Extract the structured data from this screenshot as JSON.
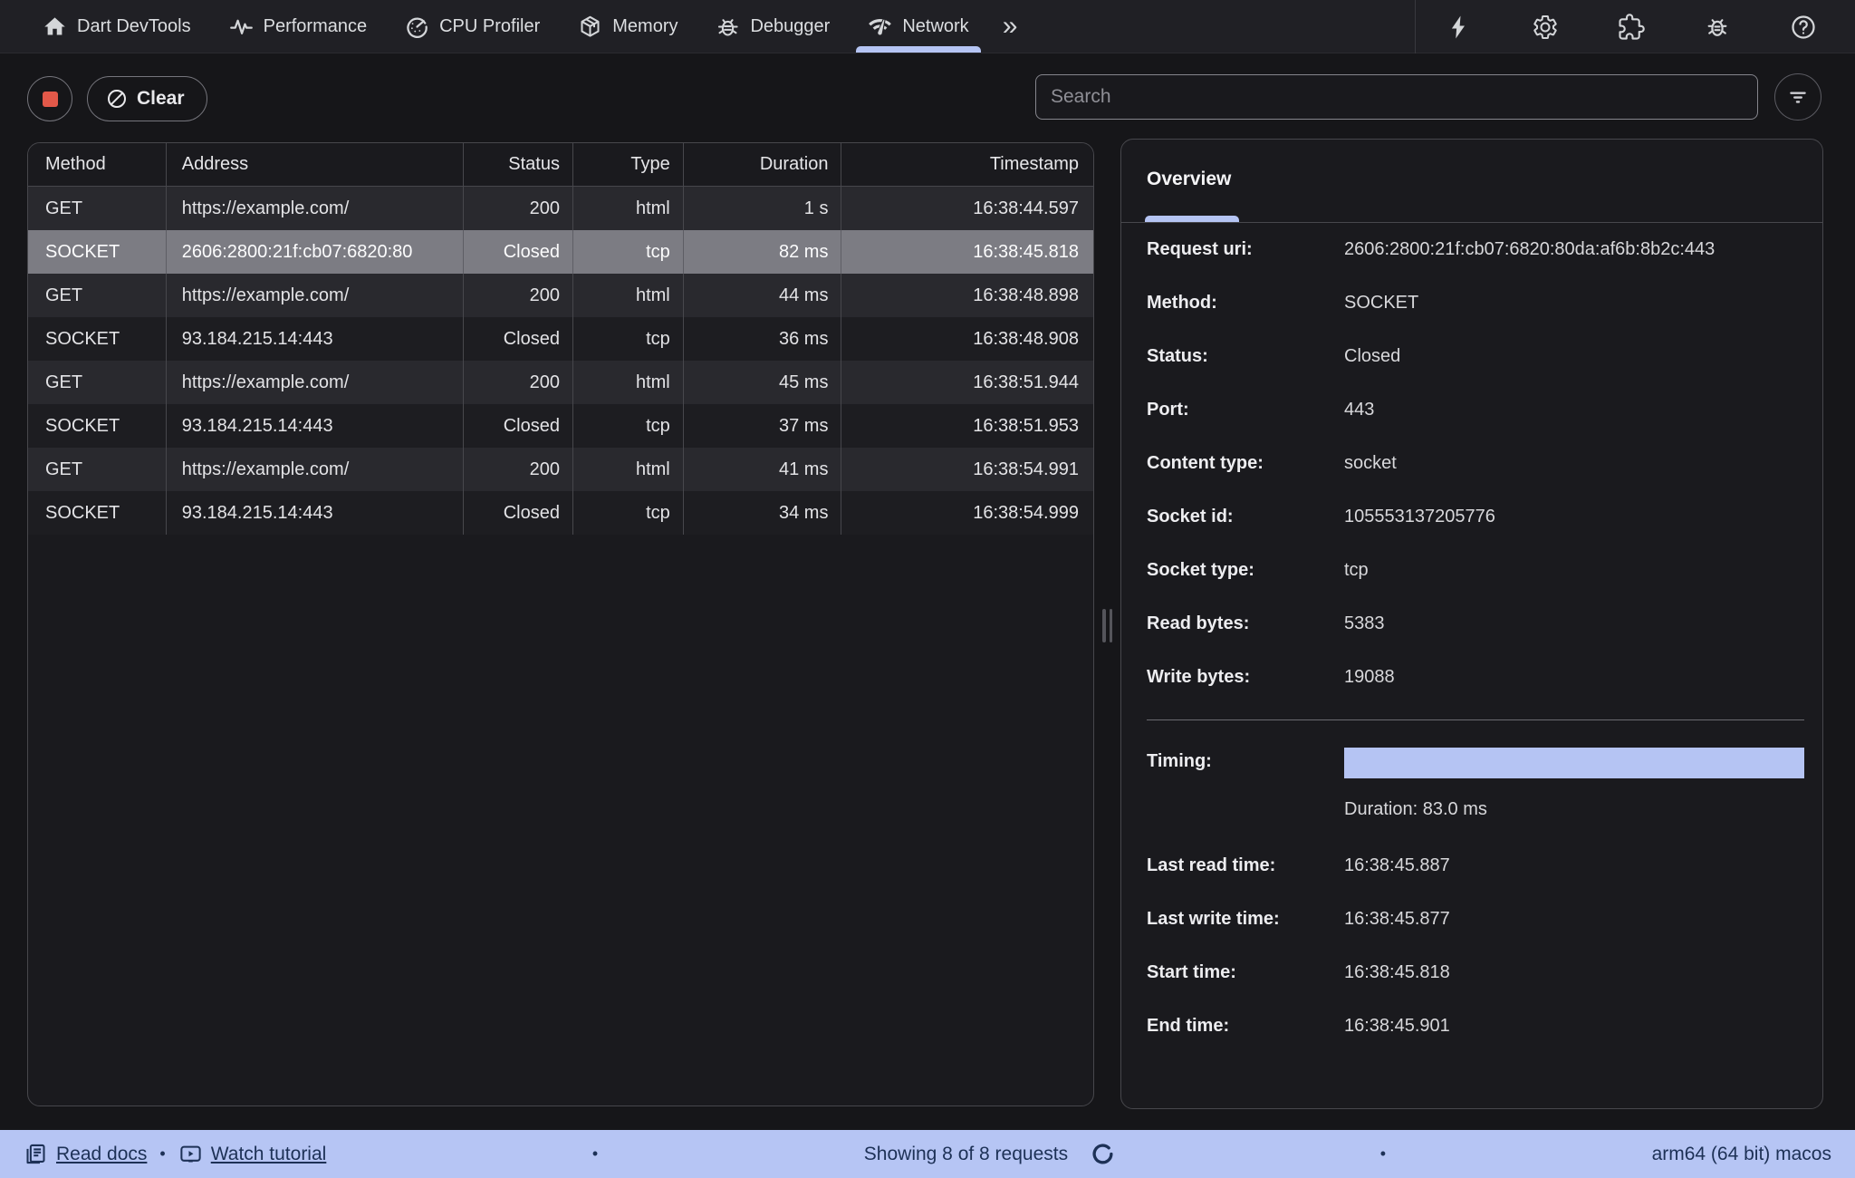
{
  "topnav": {
    "items": [
      {
        "label": "Dart DevTools",
        "icon": "home-icon",
        "selected": false
      },
      {
        "label": "Performance",
        "icon": "performance-icon",
        "selected": false
      },
      {
        "label": "CPU Profiler",
        "icon": "cpu-profiler-icon",
        "selected": false
      },
      {
        "label": "Memory",
        "icon": "memory-icon",
        "selected": false
      },
      {
        "label": "Debugger",
        "icon": "debugger-icon",
        "selected": false
      },
      {
        "label": "Network",
        "icon": "network-icon",
        "selected": true
      }
    ],
    "overflow_glyph": "»",
    "action_icons": [
      "lightning-icon",
      "settings-icon",
      "extensions-icon",
      "report-bug-icon",
      "help-icon"
    ]
  },
  "toolbar": {
    "clear_label": "Clear",
    "search_placeholder": "Search",
    "search_value": ""
  },
  "table": {
    "columns": [
      "Method",
      "Address",
      "Status",
      "Type",
      "Duration",
      "Timestamp"
    ],
    "rows": [
      {
        "method": "GET",
        "address": "https://example.com/",
        "status": "200",
        "type": "html",
        "duration": "1 s",
        "timestamp": "16:38:44.597"
      },
      {
        "method": "SOCKET",
        "address": "2606:2800:21f:cb07:6820:80",
        "status": "Closed",
        "type": "tcp",
        "duration": "82 ms",
        "timestamp": "16:38:45.818"
      },
      {
        "method": "GET",
        "address": "https://example.com/",
        "status": "200",
        "type": "html",
        "duration": "44 ms",
        "timestamp": "16:38:48.898"
      },
      {
        "method": "SOCKET",
        "address": "93.184.215.14:443",
        "status": "Closed",
        "type": "tcp",
        "duration": "36 ms",
        "timestamp": "16:38:48.908"
      },
      {
        "method": "GET",
        "address": "https://example.com/",
        "status": "200",
        "type": "html",
        "duration": "45 ms",
        "timestamp": "16:38:51.944"
      },
      {
        "method": "SOCKET",
        "address": "93.184.215.14:443",
        "status": "Closed",
        "type": "tcp",
        "duration": "37 ms",
        "timestamp": "16:38:51.953"
      },
      {
        "method": "GET",
        "address": "https://example.com/",
        "status": "200",
        "type": "html",
        "duration": "41 ms",
        "timestamp": "16:38:54.991"
      },
      {
        "method": "SOCKET",
        "address": "93.184.215.14:443",
        "status": "Closed",
        "type": "tcp",
        "duration": "34 ms",
        "timestamp": "16:38:54.999"
      }
    ],
    "selected_row_index": 1
  },
  "overview": {
    "tab_label": "Overview",
    "fields": [
      {
        "label": "Request uri:",
        "value": "2606:2800:21f:cb07:6820:80da:af6b:8b2c:443"
      },
      {
        "label": "Method:",
        "value": "SOCKET"
      },
      {
        "label": "Status:",
        "value": "Closed"
      },
      {
        "label": "Port:",
        "value": "443"
      },
      {
        "label": "Content type:",
        "value": "socket"
      },
      {
        "label": "Socket id:",
        "value": "105553137205776"
      },
      {
        "label": "Socket type:",
        "value": "tcp"
      },
      {
        "label": "Read bytes:",
        "value": "5383"
      },
      {
        "label": "Write bytes:",
        "value": "19088"
      }
    ],
    "timing_label": "Timing:",
    "timing_duration": "Duration: 83.0 ms",
    "time_fields": [
      {
        "label": "Last read time:",
        "value": "16:38:45.887"
      },
      {
        "label": "Last write time:",
        "value": "16:38:45.877"
      },
      {
        "label": "Start time:",
        "value": "16:38:45.818"
      },
      {
        "label": "End time:",
        "value": "16:38:45.901"
      }
    ]
  },
  "statusbar": {
    "read_docs": "Read docs",
    "watch_tutorial": "Watch tutorial",
    "separator": "•",
    "showing": "Showing 8 of 8 requests",
    "platform": "arm64 (64 bit) macos"
  },
  "colors": {
    "accent_periwinkle": "#b5c4f3",
    "record_red": "#e25849",
    "row_selected_gray": "#7c7c83",
    "statusbar_bg": "#b6c5f4",
    "statusbar_text": "#1d3156",
    "panel_border": "#47474c"
  }
}
